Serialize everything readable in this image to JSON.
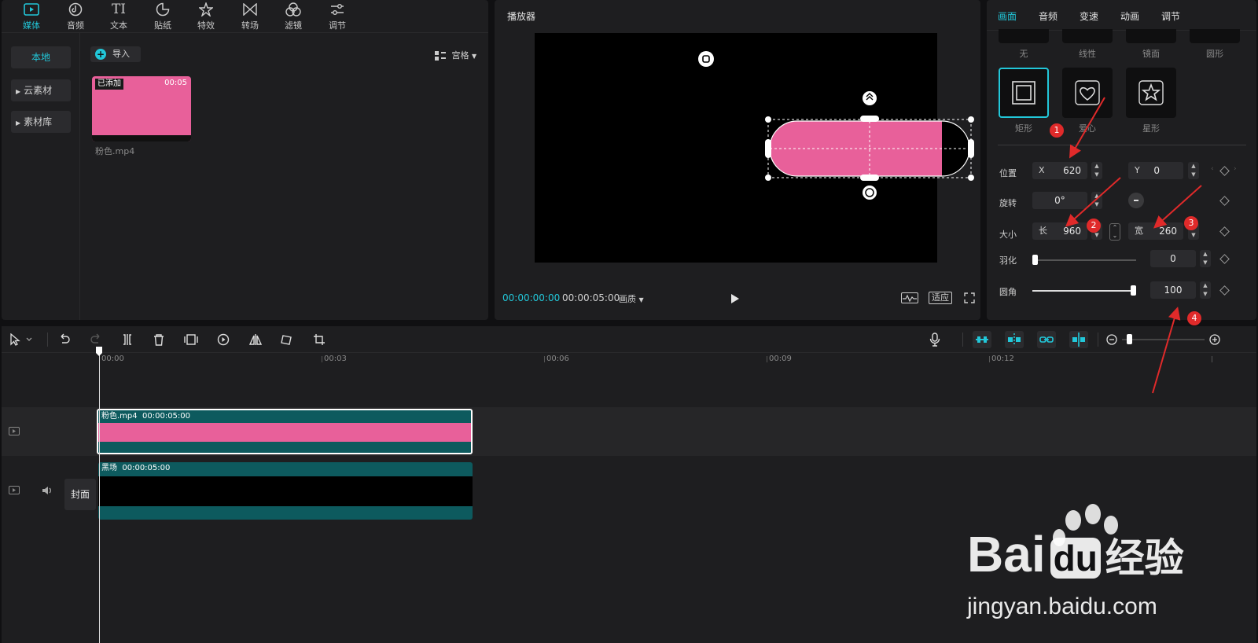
{
  "media": {
    "tools": [
      {
        "label": "媒体",
        "icon": "media-icon",
        "active": true
      },
      {
        "label": "音频",
        "icon": "audio-icon"
      },
      {
        "label": "文本",
        "icon": "text-icon",
        "glyph": "TI"
      },
      {
        "label": "贴纸",
        "icon": "sticker-icon"
      },
      {
        "label": "特效",
        "icon": "effects-icon"
      },
      {
        "label": "转场",
        "icon": "transition-icon"
      },
      {
        "label": "滤镜",
        "icon": "filter-icon"
      },
      {
        "label": "调节",
        "icon": "adjust-icon"
      }
    ],
    "sidebar": [
      {
        "label": "本地"
      },
      {
        "label": "云素材"
      },
      {
        "label": "素材库"
      }
    ],
    "import_label": "导入",
    "view_label": "宫格",
    "clip": {
      "added": "已添加",
      "duration": "00:05",
      "name": "粉色.mp4"
    }
  },
  "player": {
    "title": "播放器",
    "current_time": "00:00:00:00",
    "total_time": "00:00:05:00",
    "quality_label": "画质",
    "fit_label": "适应"
  },
  "props": {
    "tabs": [
      {
        "label": "画面",
        "active": true
      },
      {
        "label": "音频"
      },
      {
        "label": "变速"
      },
      {
        "label": "动画"
      },
      {
        "label": "调节"
      }
    ],
    "top_shapes": [
      "无",
      "线性",
      "镜面",
      "圆形"
    ],
    "shapes": [
      {
        "label": "矩形",
        "icon": "rectangle-icon",
        "selected": true
      },
      {
        "label": "爱心",
        "icon": "heart-icon"
      },
      {
        "label": "星形",
        "icon": "star-icon"
      }
    ],
    "position": {
      "label": "位置",
      "x_prefix": "X",
      "x": "620",
      "y_prefix": "Y",
      "y": "0"
    },
    "rotation": {
      "label": "旋转",
      "value": "0°"
    },
    "size": {
      "label": "大小",
      "length_prefix": "长",
      "length": "960",
      "width_prefix": "宽",
      "width": "260"
    },
    "feather": {
      "label": "羽化",
      "value": "0",
      "level": 0
    },
    "corner": {
      "label": "圆角",
      "value": "100",
      "level": 100
    }
  },
  "timeline": {
    "ruler": [
      "00:00",
      "00:03",
      "00:06",
      "00:09",
      "00:12"
    ],
    "tracks": [
      {
        "name": "粉色.mp4",
        "duration": "00:00:05:00",
        "color": "#e8609a"
      },
      {
        "name": "黑场",
        "duration": "00:00:05:00",
        "color": "#000000"
      }
    ],
    "cover_label": "封面"
  },
  "annotations": [
    "1",
    "2",
    "3",
    "4"
  ],
  "watermark": {
    "brand_a": "Bai",
    "brand_b": "du",
    "brand_c": "经验",
    "url": "jingyan.baidu.com"
  },
  "colors": {
    "accent": "#22c7d9",
    "clip_pink": "#e8609a",
    "track_teal": "#0d5a5e",
    "arrow_red": "#e02a2a"
  }
}
